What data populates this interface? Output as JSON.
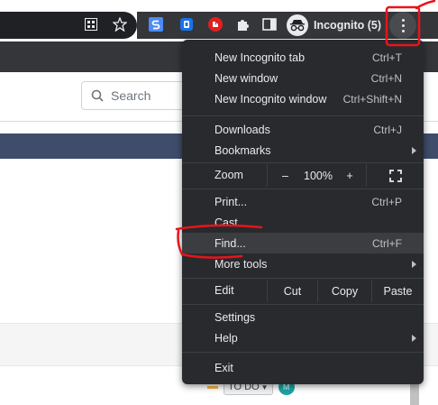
{
  "toolbar": {
    "incognito_label": "Incognito (5)",
    "icons": [
      "extensions-grid-icon",
      "star-icon",
      "s-extension-icon",
      "blue-extension-icon",
      "red-shield-icon",
      "puzzle-icon",
      "sidebar-icon",
      "incognito-icon",
      "more-vert-icon"
    ]
  },
  "page": {
    "search_placeholder": "Search",
    "todo_label": "TO DO",
    "avatar_initial": "M"
  },
  "menu": {
    "new_incognito_tab": "New Incognito tab",
    "new_incognito_tab_shortcut": "Ctrl+T",
    "new_window": "New window",
    "new_window_shortcut": "Ctrl+N",
    "new_incognito_window": "New Incognito window",
    "new_incognito_window_shortcut": "Ctrl+Shift+N",
    "downloads": "Downloads",
    "downloads_shortcut": "Ctrl+J",
    "bookmarks": "Bookmarks",
    "zoom_label": "Zoom",
    "zoom_minus": "–",
    "zoom_value": "100%",
    "zoom_plus": "+",
    "print": "Print...",
    "print_shortcut": "Ctrl+P",
    "cast": "Cast...",
    "find": "Find...",
    "find_shortcut": "Ctrl+F",
    "more_tools": "More tools",
    "edit_label": "Edit",
    "cut": "Cut",
    "copy": "Copy",
    "paste": "Paste",
    "settings": "Settings",
    "help": "Help",
    "exit": "Exit"
  },
  "colors": {
    "menu_bg": "#292a2d",
    "menu_highlight": "#3c3d41",
    "annotation_red": "#e8141c",
    "header_band": "#3f4d6b"
  }
}
